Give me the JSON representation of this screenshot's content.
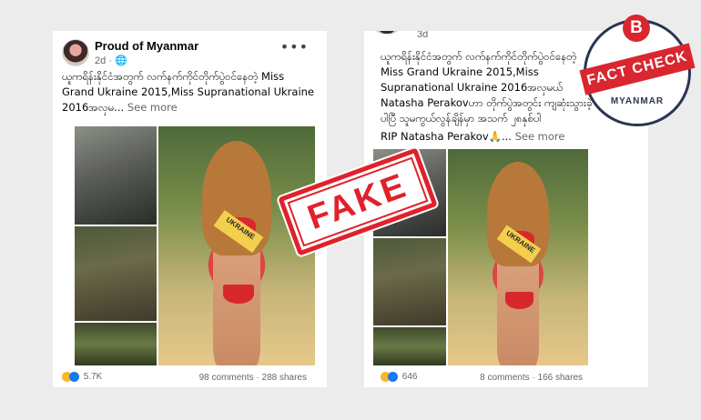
{
  "left_post": {
    "page_name": "Proud of Myanmar",
    "time": "2d ·",
    "text": "ယူကရိန်းနိုင်ငံအတွက် လက်နက်ကိုင်တိုက်ပွဲဝင်နေတဲ့ Miss Grand Ukraine 2015,Miss Supranational Ukraine 2016အလှမ...",
    "see_more": "See more",
    "sash_text": "UKRAINE",
    "reaction_count": "5.7K",
    "stats": "98 comments · 288 shares"
  },
  "right_post": {
    "time": "3d",
    "text": "ယူကရိန်းနိုင်ငံအတွက် လက်နက်ကိုင်တိုက်ပွဲဝင်နေတဲ့ Miss Grand Ukraine 2015,Miss Supranational Ukraine 2016အလှမယ် Natasha Perakovဟာ တိုက်ပွဲအတွင်း ကျဆုံးသွားခဲ့ပါပြီ သူမကွယ်လွန်ချိန်မှာ အသက် ၂၈နှစ်ပါ",
    "rip_line": "RIP Natasha Perakov🙏...",
    "see_more": "See more",
    "sash_text": "UKRAINE",
    "reaction_count": "646",
    "stats": "8 comments · 166 shares"
  },
  "stamps": {
    "fake": "FAKE",
    "fc_letter": "B",
    "fc_banner": "FACT CHECK",
    "fc_country": "MYANMAR"
  },
  "colors": {
    "stamp_red": "#e0212b",
    "seal_navy": "#2a3550",
    "facebook_blue": "#1877f2"
  }
}
